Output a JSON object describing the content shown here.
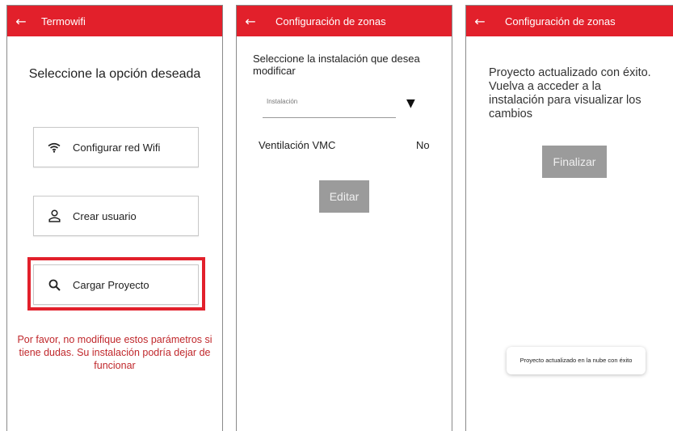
{
  "screen1": {
    "title": "Termowifi",
    "heading": "Seleccione la opción deseada",
    "buttons": [
      {
        "label": "Configurar red Wifi",
        "icon": "wifi-icon"
      },
      {
        "label": "Crear usuario",
        "icon": "user-icon"
      },
      {
        "label": "Cargar Proyecto",
        "icon": "search-icon"
      }
    ],
    "warning": "Por favor, no modifique estos parámetros si tiene dudas. Su instalación podría dejar de funcionar"
  },
  "screen2": {
    "title": "Configuración de zonas",
    "prompt": "Seleccione la instalación que desea modificar",
    "select_placeholder": "Instalación",
    "row_label": "Ventilación VMC",
    "row_value": "No",
    "edit_label": "Editar"
  },
  "screen3": {
    "title": "Configuración de zonas",
    "message": "Proyecto actualizado con éxito. Vuelva a acceder a la instalación para visualizar los cambios",
    "finish_label": "Finalizar",
    "toast": "Proyecto actualizado en la nube con éxito"
  },
  "icons": {
    "back": "arrow-left-icon",
    "dropdown": "triangle-down-icon"
  },
  "colors": {
    "brand_red": "#e2202b",
    "warning_text": "#c0282c",
    "disabled_button": "#9b9b9b"
  }
}
